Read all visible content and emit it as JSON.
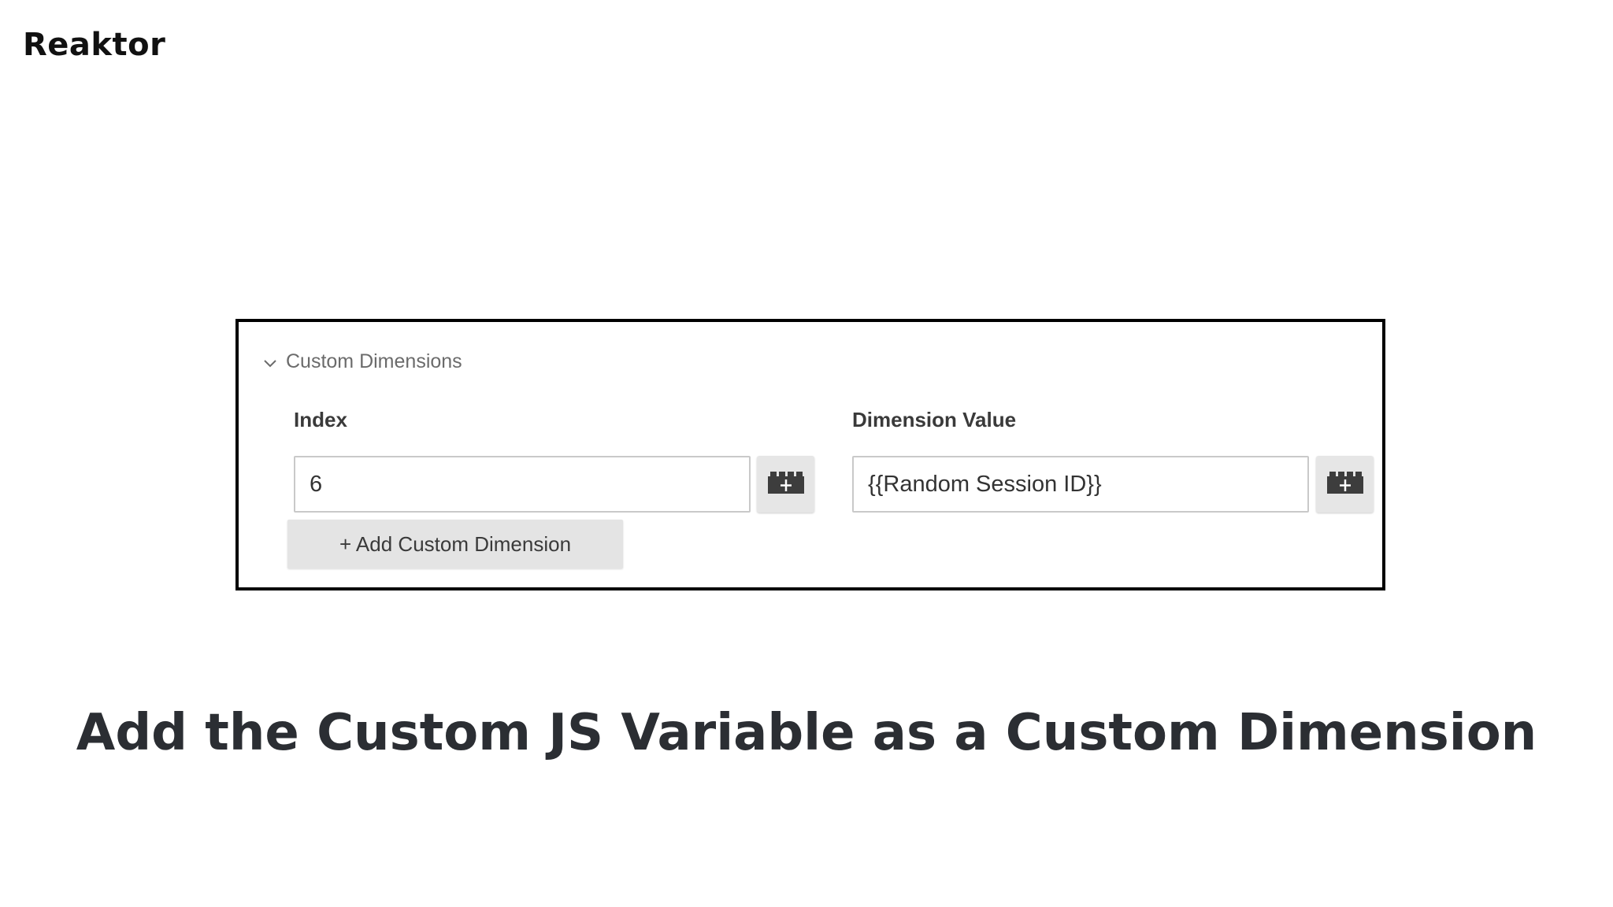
{
  "brand": {
    "logo_text": "Reaktor"
  },
  "panel": {
    "section_title": "Custom Dimensions",
    "index_label": "Index",
    "index_value": "6",
    "dimension_label": "Dimension Value",
    "dimension_value": "{{Random Session ID}}",
    "add_button_label": "+ Add Custom Dimension",
    "icons": {
      "collapse": "chevron-down-icon",
      "variable_picker": "lego-brick-plus-icon"
    }
  },
  "caption": "Add the Custom JS Variable as a Custom Dimension",
  "colors": {
    "panel_border": "#000000",
    "button_bg": "#e4e4e4",
    "caption_text": "#2b2e33"
  }
}
